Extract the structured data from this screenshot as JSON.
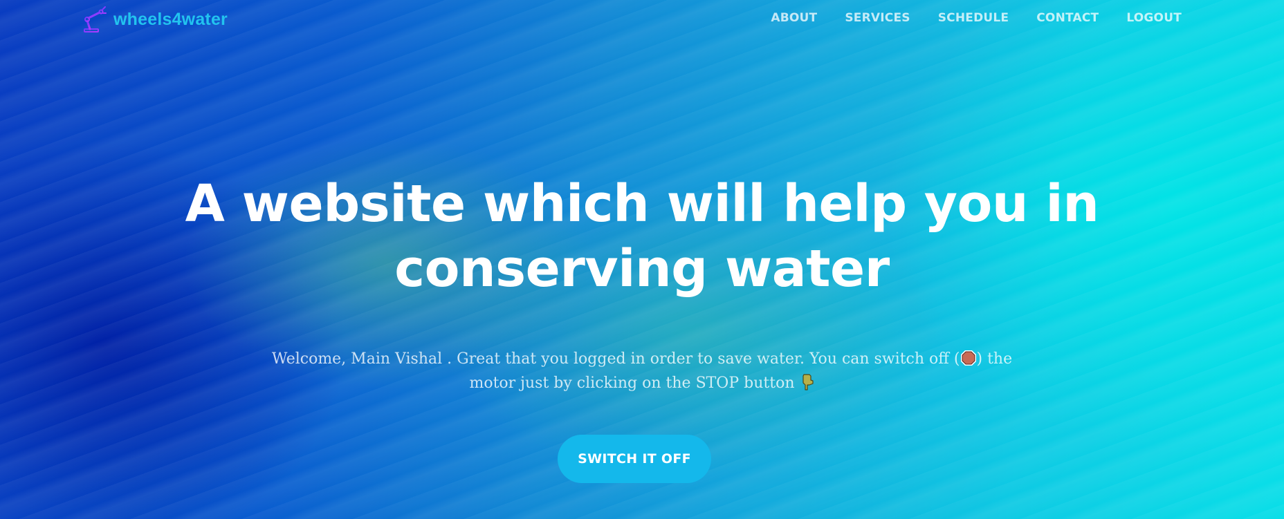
{
  "brand": {
    "name": "wheels4water",
    "icon": "robot-arm-icon"
  },
  "nav": {
    "items": [
      {
        "label": "ABOUT"
      },
      {
        "label": "SERVICES"
      },
      {
        "label": "SCHEDULE"
      },
      {
        "label": "CONTACT"
      },
      {
        "label": "LOGOUT"
      }
    ]
  },
  "hero": {
    "title_line1": "A website which will help you in",
    "title_line2": "conserving water",
    "subtitle_part1": "Welcome, Main Vishal . Great that you logged in order to save water. You can switch off (",
    "subtitle_part2": ") the motor just by clicking on the STOP button",
    "stop_icon": "stop-sign-icon",
    "pointer_icon": "hand-pointing-down-icon",
    "cta_label": "SWITCH IT OFF"
  },
  "colors": {
    "brand": "#22c3ef",
    "cta": "#14b8eb",
    "text": "#ffffff"
  }
}
